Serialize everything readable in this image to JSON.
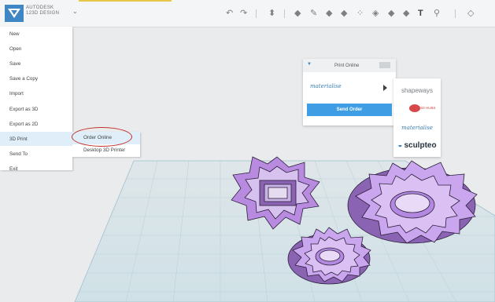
{
  "app": {
    "brand_line1": "AUTODESK",
    "brand_line2": "123D DESIGN"
  },
  "toolbar": {
    "undo_icon": "undo-icon",
    "redo_icon": "redo-icon",
    "tools": [
      "transform-icon",
      "primitives-icon",
      "sketch-icon",
      "construct-icon",
      "modify-icon",
      "pattern-icon",
      "grouping-icon",
      "combine-icon",
      "measure-icon",
      "text-icon",
      "snap-icon",
      "material-icon"
    ],
    "text_tool_label": "T"
  },
  "file_menu": {
    "items": [
      "New",
      "Open",
      "Save",
      "Save a Copy",
      "Import",
      "Export as 3D",
      "Export as 2D",
      "3D Print",
      "Send To",
      "Exit"
    ],
    "active_index": 7
  },
  "submenu": {
    "items": [
      "Order Online",
      "Desktop 3D Printer"
    ],
    "active_index": 0
  },
  "print_panel": {
    "title": "Print Online",
    "service": "materialise",
    "send_button": "Send Order"
  },
  "vendors": {
    "shapeways": "shapeways",
    "threed": "3D HUBS",
    "materialise": "materialise",
    "sculpteo": "sculpteo"
  },
  "colors": {
    "accent": "#3f86c4",
    "highlight_circle": "#c4312a",
    "model_purple": "#b98be0",
    "send_button": "#3f9ee3"
  }
}
